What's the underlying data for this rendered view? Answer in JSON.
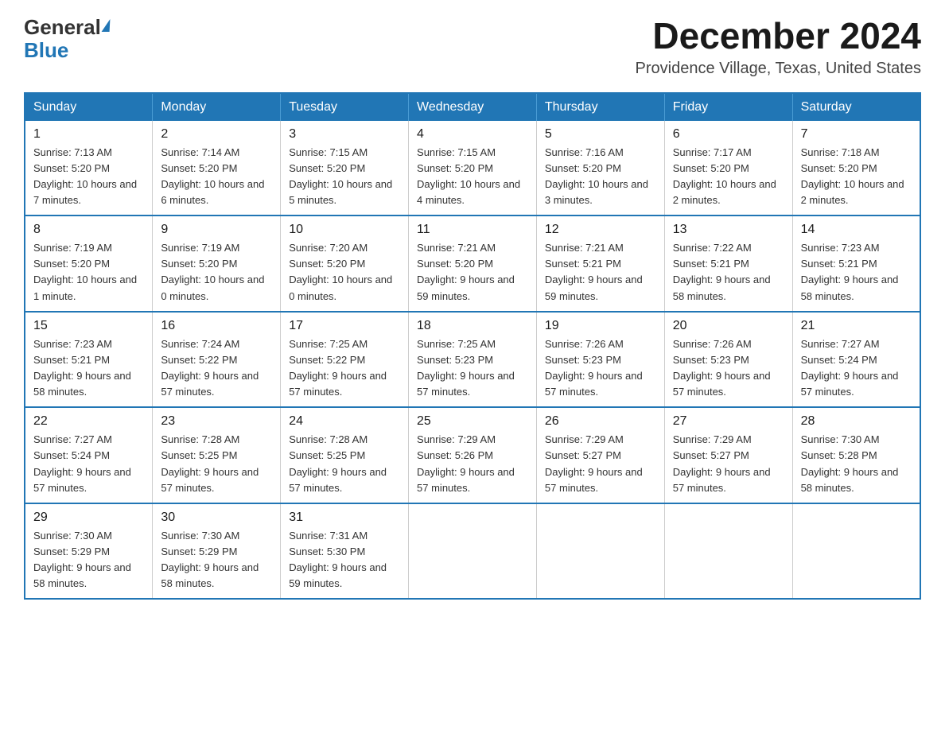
{
  "header": {
    "logo_general": "General",
    "logo_blue": "Blue",
    "month_title": "December 2024",
    "location": "Providence Village, Texas, United States"
  },
  "weekdays": [
    "Sunday",
    "Monday",
    "Tuesday",
    "Wednesday",
    "Thursday",
    "Friday",
    "Saturday"
  ],
  "weeks": [
    [
      {
        "day": "1",
        "sunrise": "7:13 AM",
        "sunset": "5:20 PM",
        "daylight": "10 hours and 7 minutes."
      },
      {
        "day": "2",
        "sunrise": "7:14 AM",
        "sunset": "5:20 PM",
        "daylight": "10 hours and 6 minutes."
      },
      {
        "day": "3",
        "sunrise": "7:15 AM",
        "sunset": "5:20 PM",
        "daylight": "10 hours and 5 minutes."
      },
      {
        "day": "4",
        "sunrise": "7:15 AM",
        "sunset": "5:20 PM",
        "daylight": "10 hours and 4 minutes."
      },
      {
        "day": "5",
        "sunrise": "7:16 AM",
        "sunset": "5:20 PM",
        "daylight": "10 hours and 3 minutes."
      },
      {
        "day": "6",
        "sunrise": "7:17 AM",
        "sunset": "5:20 PM",
        "daylight": "10 hours and 2 minutes."
      },
      {
        "day": "7",
        "sunrise": "7:18 AM",
        "sunset": "5:20 PM",
        "daylight": "10 hours and 2 minutes."
      }
    ],
    [
      {
        "day": "8",
        "sunrise": "7:19 AM",
        "sunset": "5:20 PM",
        "daylight": "10 hours and 1 minute."
      },
      {
        "day": "9",
        "sunrise": "7:19 AM",
        "sunset": "5:20 PM",
        "daylight": "10 hours and 0 minutes."
      },
      {
        "day": "10",
        "sunrise": "7:20 AM",
        "sunset": "5:20 PM",
        "daylight": "10 hours and 0 minutes."
      },
      {
        "day": "11",
        "sunrise": "7:21 AM",
        "sunset": "5:20 PM",
        "daylight": "9 hours and 59 minutes."
      },
      {
        "day": "12",
        "sunrise": "7:21 AM",
        "sunset": "5:21 PM",
        "daylight": "9 hours and 59 minutes."
      },
      {
        "day": "13",
        "sunrise": "7:22 AM",
        "sunset": "5:21 PM",
        "daylight": "9 hours and 58 minutes."
      },
      {
        "day": "14",
        "sunrise": "7:23 AM",
        "sunset": "5:21 PM",
        "daylight": "9 hours and 58 minutes."
      }
    ],
    [
      {
        "day": "15",
        "sunrise": "7:23 AM",
        "sunset": "5:21 PM",
        "daylight": "9 hours and 58 minutes."
      },
      {
        "day": "16",
        "sunrise": "7:24 AM",
        "sunset": "5:22 PM",
        "daylight": "9 hours and 57 minutes."
      },
      {
        "day": "17",
        "sunrise": "7:25 AM",
        "sunset": "5:22 PM",
        "daylight": "9 hours and 57 minutes."
      },
      {
        "day": "18",
        "sunrise": "7:25 AM",
        "sunset": "5:23 PM",
        "daylight": "9 hours and 57 minutes."
      },
      {
        "day": "19",
        "sunrise": "7:26 AM",
        "sunset": "5:23 PM",
        "daylight": "9 hours and 57 minutes."
      },
      {
        "day": "20",
        "sunrise": "7:26 AM",
        "sunset": "5:23 PM",
        "daylight": "9 hours and 57 minutes."
      },
      {
        "day": "21",
        "sunrise": "7:27 AM",
        "sunset": "5:24 PM",
        "daylight": "9 hours and 57 minutes."
      }
    ],
    [
      {
        "day": "22",
        "sunrise": "7:27 AM",
        "sunset": "5:24 PM",
        "daylight": "9 hours and 57 minutes."
      },
      {
        "day": "23",
        "sunrise": "7:28 AM",
        "sunset": "5:25 PM",
        "daylight": "9 hours and 57 minutes."
      },
      {
        "day": "24",
        "sunrise": "7:28 AM",
        "sunset": "5:25 PM",
        "daylight": "9 hours and 57 minutes."
      },
      {
        "day": "25",
        "sunrise": "7:29 AM",
        "sunset": "5:26 PM",
        "daylight": "9 hours and 57 minutes."
      },
      {
        "day": "26",
        "sunrise": "7:29 AM",
        "sunset": "5:27 PM",
        "daylight": "9 hours and 57 minutes."
      },
      {
        "day": "27",
        "sunrise": "7:29 AM",
        "sunset": "5:27 PM",
        "daylight": "9 hours and 57 minutes."
      },
      {
        "day": "28",
        "sunrise": "7:30 AM",
        "sunset": "5:28 PM",
        "daylight": "9 hours and 58 minutes."
      }
    ],
    [
      {
        "day": "29",
        "sunrise": "7:30 AM",
        "sunset": "5:29 PM",
        "daylight": "9 hours and 58 minutes."
      },
      {
        "day": "30",
        "sunrise": "7:30 AM",
        "sunset": "5:29 PM",
        "daylight": "9 hours and 58 minutes."
      },
      {
        "day": "31",
        "sunrise": "7:31 AM",
        "sunset": "5:30 PM",
        "daylight": "9 hours and 59 minutes."
      },
      null,
      null,
      null,
      null
    ]
  ],
  "labels": {
    "sunrise": "Sunrise:",
    "sunset": "Sunset:",
    "daylight": "Daylight:"
  }
}
